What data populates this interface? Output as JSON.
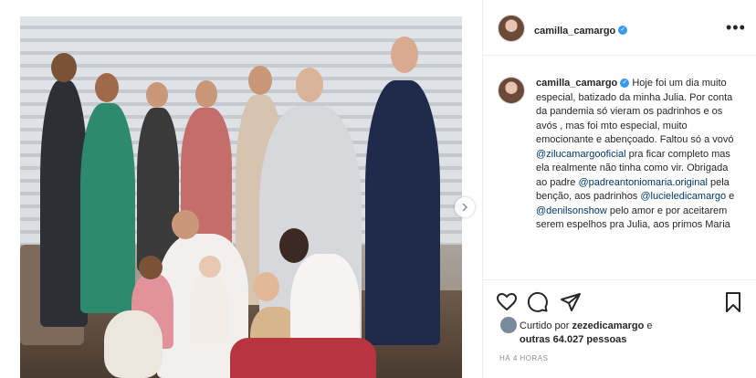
{
  "post": {
    "author": "camilla_camargo",
    "caption": {
      "username": "camilla_camargo",
      "parts": [
        {
          "type": "text",
          "value": " Hoje foi um dia muito especial, batizado da minha Julia. Por conta da pandemia só vieram os padrinhos e os avós , mas foi mto especial, muito emocionante e abençoado. Faltou só a vovó "
        },
        {
          "type": "mention",
          "value": "@zilucamargooficial"
        },
        {
          "type": "text",
          "value": " pra ficar completo mas ela realmente não tinha como vir. Obrigada ao padre "
        },
        {
          "type": "mention",
          "value": "@padreantoniomaria.original"
        },
        {
          "type": "text",
          "value": " pela benção, aos padrinhos "
        },
        {
          "type": "mention",
          "value": "@lucieledicamargo"
        },
        {
          "type": "text",
          "value": " e "
        },
        {
          "type": "mention",
          "value": "@denilsonshow"
        },
        {
          "type": "text",
          "value": " pelo amor e por aceitarem serem espelhos pra Julia, aos primos Maria"
        }
      ]
    },
    "likes": {
      "prefix": "Curtido por",
      "user": "zezedicamargo",
      "connector": "e",
      "others": "outras 64.027 pessoas"
    },
    "time": "HÁ 4 HORAS"
  },
  "icons": {
    "more": "more-options-icon",
    "verified": "verified-badge-icon",
    "like": "heart-icon",
    "comment": "comment-icon",
    "share": "share-icon",
    "save": "bookmark-icon",
    "next": "chevron-right-icon"
  },
  "colors": {
    "verified": "#3897f0",
    "mention": "#00376b",
    "text": "#262626",
    "muted": "#8e8e8e"
  }
}
